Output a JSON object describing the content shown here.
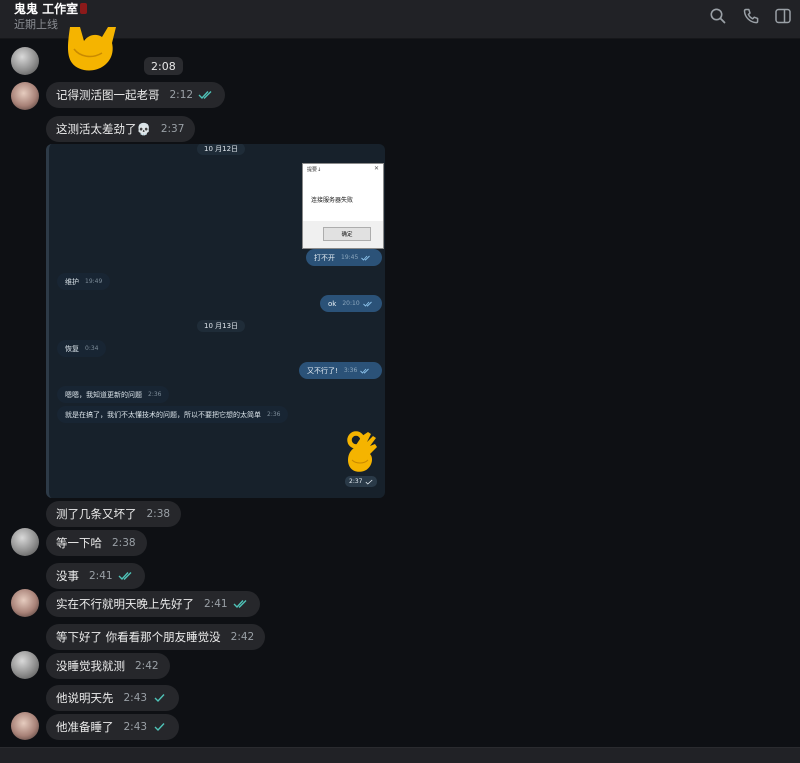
{
  "header": {
    "title": "鬼鬼 工作室",
    "status": "近期上线",
    "icons": [
      "search-icon",
      "phone-icon",
      "sidebar-toggle-icon"
    ]
  },
  "colors": {
    "background": "#0e1014",
    "bubble": "#26272b",
    "header": "#212226",
    "read_tick": "#4fc3b8",
    "embedded_bg": "#17212b",
    "embedded_out": "#2b5278"
  },
  "messages": {
    "m0_time": "2:08",
    "m1": {
      "text": "记得测活图一起老哥",
      "time": "2:12"
    },
    "m2": {
      "text": "这测活太差劲了💀",
      "time": "2:37"
    },
    "m3": {
      "text": "测了几条又坏了",
      "time": "2:38"
    },
    "m4": {
      "text": "等一下哈",
      "time": "2:38"
    },
    "m5": {
      "text": "没事",
      "time": "2:41"
    },
    "m6": {
      "text": "实在不行就明天晚上先好了",
      "time": "2:41"
    },
    "m7": {
      "text": "等下好了 你看看那个朋友睡觉没",
      "time": "2:42"
    },
    "m8": {
      "text": "没睡觉我就测",
      "time": "2:42"
    },
    "m9": {
      "text": "他说明天先",
      "time": "2:43"
    },
    "m10": {
      "text": "他准备睡了",
      "time": "2:43"
    }
  },
  "embedded": {
    "date1": "10 月12日",
    "date2": "10 月13日",
    "dialog": {
      "title": "提要↓",
      "message": "连接服务器失败",
      "button": "确定"
    },
    "s1": {
      "text": "打不开",
      "time": "19:45"
    },
    "s2": {
      "text": "维护",
      "time": "19:49"
    },
    "s3": {
      "text": "ok",
      "time": "20:10"
    },
    "s4": {
      "text": "恢复",
      "time": "0:34"
    },
    "s5": {
      "text": "又不行了!",
      "time": "3:36"
    },
    "s6": {
      "text": "嗯嗯，我知道更新的问题",
      "time": "2:36"
    },
    "s7": {
      "text": "就是在搞了，我们不太懂技术的问题，所以不要把它想的太简单",
      "time": "2:36"
    },
    "sticker_time": "2:37"
  }
}
